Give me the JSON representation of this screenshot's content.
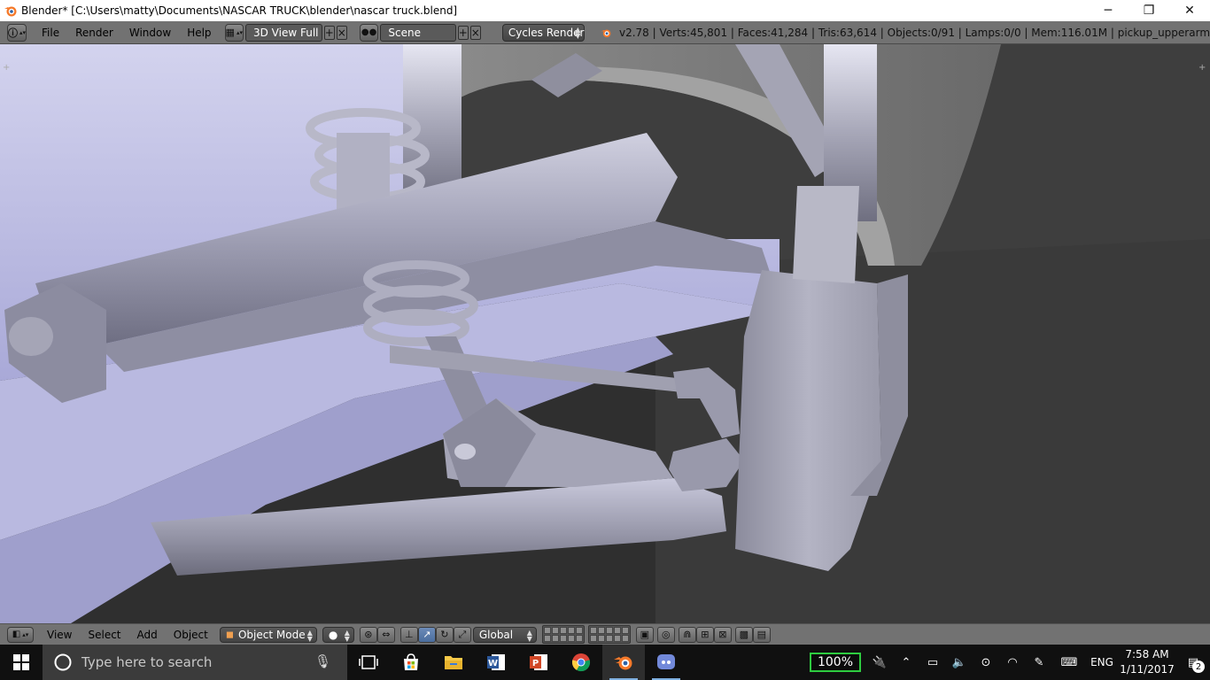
{
  "window": {
    "title": "Blender* [C:\\Users\\matty\\Documents\\NASCAR TRUCK\\blender\\nascar truck.blend]",
    "minimize": "─",
    "restore": "❐",
    "close": "✕"
  },
  "info_header": {
    "menus": [
      "File",
      "Render",
      "Window",
      "Help"
    ],
    "screen_layout": "3D View Full",
    "scene": "Scene",
    "render_engine": "Cycles Render",
    "stats": "v2.78 | Verts:45,801 | Faces:41,284 | Tris:63,614 | Objects:0/91 | Lamps:0/0 | Mem:116.01M | pickup_upperarm"
  },
  "view_header": {
    "menus": [
      "View",
      "Select",
      "Add",
      "Object"
    ],
    "mode": "Object Mode",
    "transform_orientation": "Global"
  },
  "taskbar": {
    "search_placeholder": "Type here to search",
    "battery_percent": "100%",
    "language": "ENG",
    "time": "7:58 AM",
    "date": "1/11/2017",
    "notification_count": "2",
    "pinned_apps": [
      "task-view",
      "store",
      "file-explorer",
      "word",
      "powerpoint",
      "chrome",
      "blender",
      "discord"
    ]
  },
  "colors": {
    "viewport_bg": "#3e3e3e",
    "header_bg": "#727272",
    "model_light": "#c8c8e6",
    "model_mid": "#9a9aac",
    "battery_border": "#2ecc40"
  }
}
